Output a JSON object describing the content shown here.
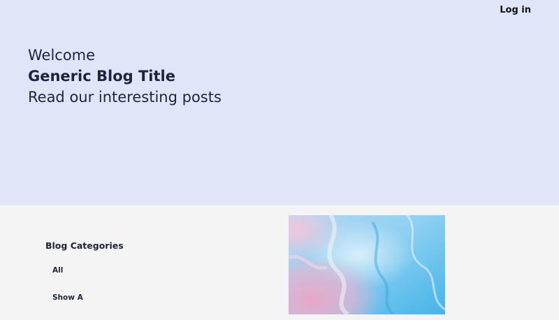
{
  "header": {
    "login_label": "Log in"
  },
  "hero": {
    "greeting": "Welcome",
    "title": "Generic Blog Title",
    "tagline": "Read our interesting posts"
  },
  "sidebar": {
    "heading": "Blog Categories",
    "items": [
      {
        "label": "All"
      },
      {
        "label": "Show A"
      }
    ]
  },
  "colors": {
    "hero_background": "#e0e6f8",
    "content_background": "#f4f4f4",
    "text_dark": "#1f2340"
  }
}
